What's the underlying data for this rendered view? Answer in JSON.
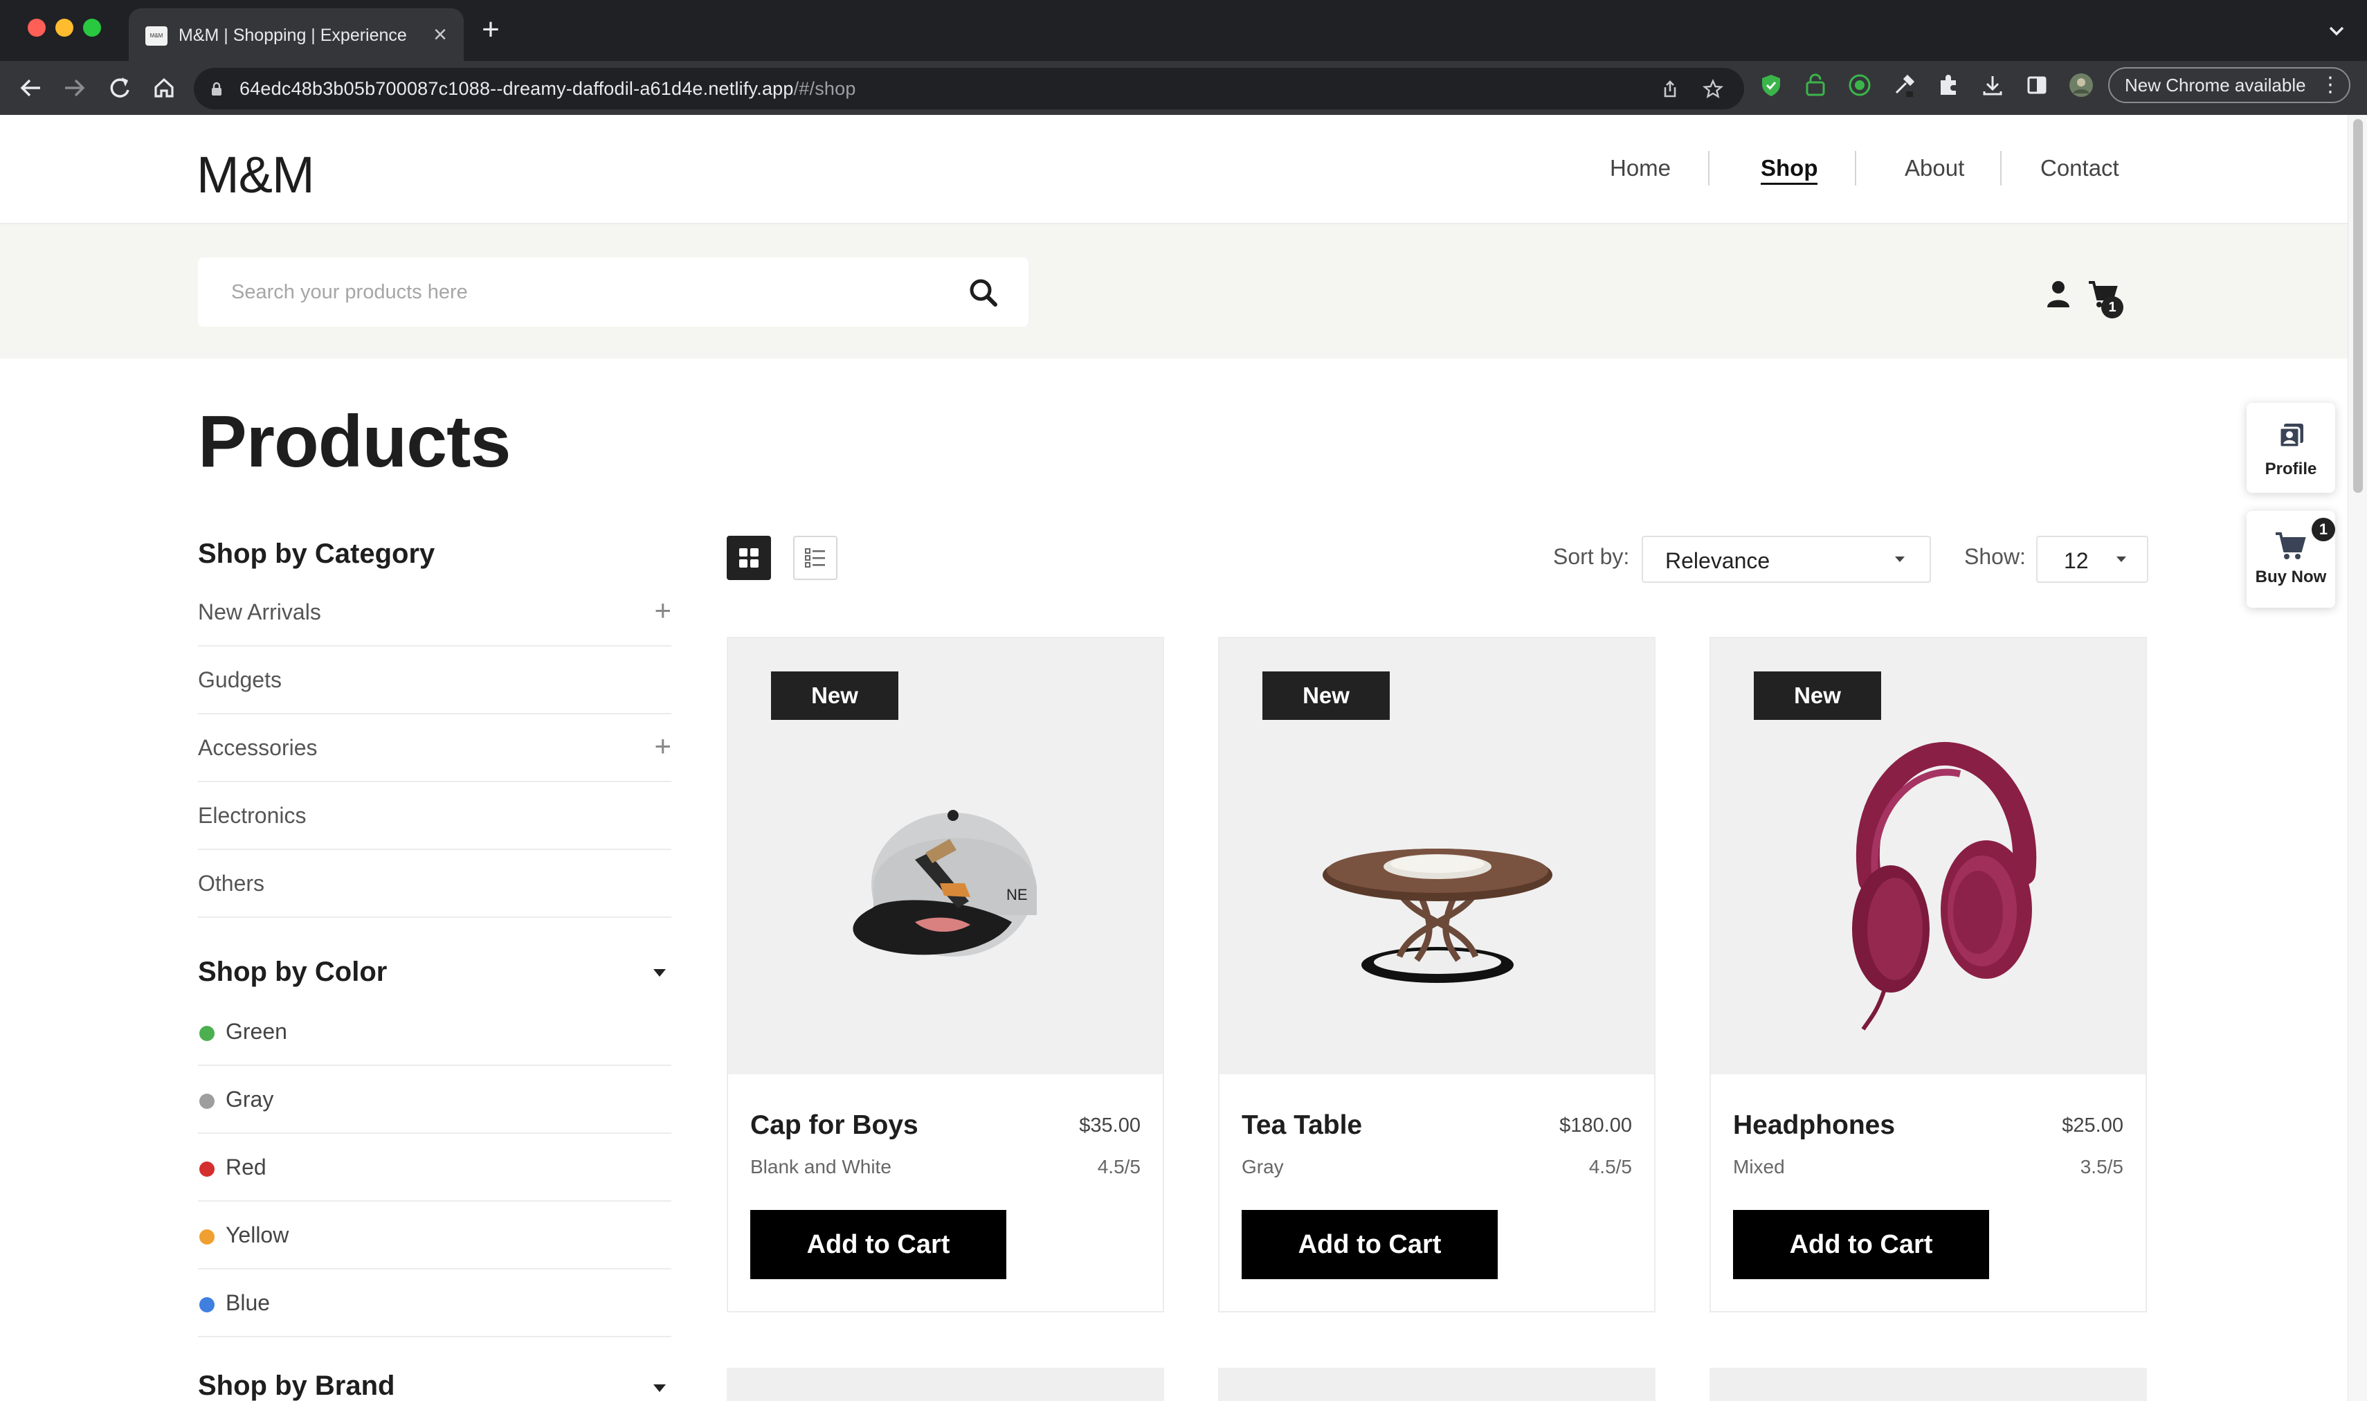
{
  "browser": {
    "tab_title": "M&M | Shopping | Experience",
    "tab_favicon_text": "M&M",
    "url_host": "64edc48b3b05b700087c1088--dreamy-daffodil-a61d4e.netlify.app",
    "url_path": "/#/shop",
    "update_button": "New Chrome available"
  },
  "site": {
    "logo": "M&M",
    "nav": [
      "Home",
      "Shop",
      "About",
      "Contact"
    ],
    "active_nav": "Shop",
    "search_placeholder": "Search your products here",
    "cart_count": "1"
  },
  "side_widget": {
    "profile_label": "Profile",
    "buy_now_label": "Buy Now",
    "buy_now_badge": "1"
  },
  "page": {
    "title": "Products",
    "category_heading": "Shop by Category",
    "categories": [
      {
        "label": "New Arrivals",
        "expandable": true
      },
      {
        "label": "Gudgets",
        "expandable": false
      },
      {
        "label": "Accessories",
        "expandable": true
      },
      {
        "label": "Electronics",
        "expandable": false
      },
      {
        "label": "Others",
        "expandable": false
      }
    ],
    "color_heading": "Shop by Color",
    "colors": [
      {
        "label": "Green",
        "hex": "#4caf50"
      },
      {
        "label": "Gray",
        "hex": "#9e9e9e"
      },
      {
        "label": "Red",
        "hex": "#d32f2f"
      },
      {
        "label": "Yellow",
        "hex": "#f0a030"
      },
      {
        "label": "Blue",
        "hex": "#3f7fe0"
      }
    ],
    "brand_heading": "Shop by Brand",
    "sort_label": "Sort by:",
    "sort_value": "Relevance",
    "show_label": "Show:",
    "show_value": "12"
  },
  "products": [
    {
      "badge": "New",
      "name": "Cap for Boys",
      "price": "$35.00",
      "color": "Blank and White",
      "rating": "4.5/5",
      "button": "Add to Cart"
    },
    {
      "badge": "New",
      "name": "Tea Table",
      "price": "$180.00",
      "color": "Gray",
      "rating": "4.5/5",
      "button": "Add to Cart"
    },
    {
      "badge": "New",
      "name": "Headphones",
      "price": "$25.00",
      "color": "Mixed",
      "rating": "3.5/5",
      "button": "Add to Cart"
    }
  ]
}
